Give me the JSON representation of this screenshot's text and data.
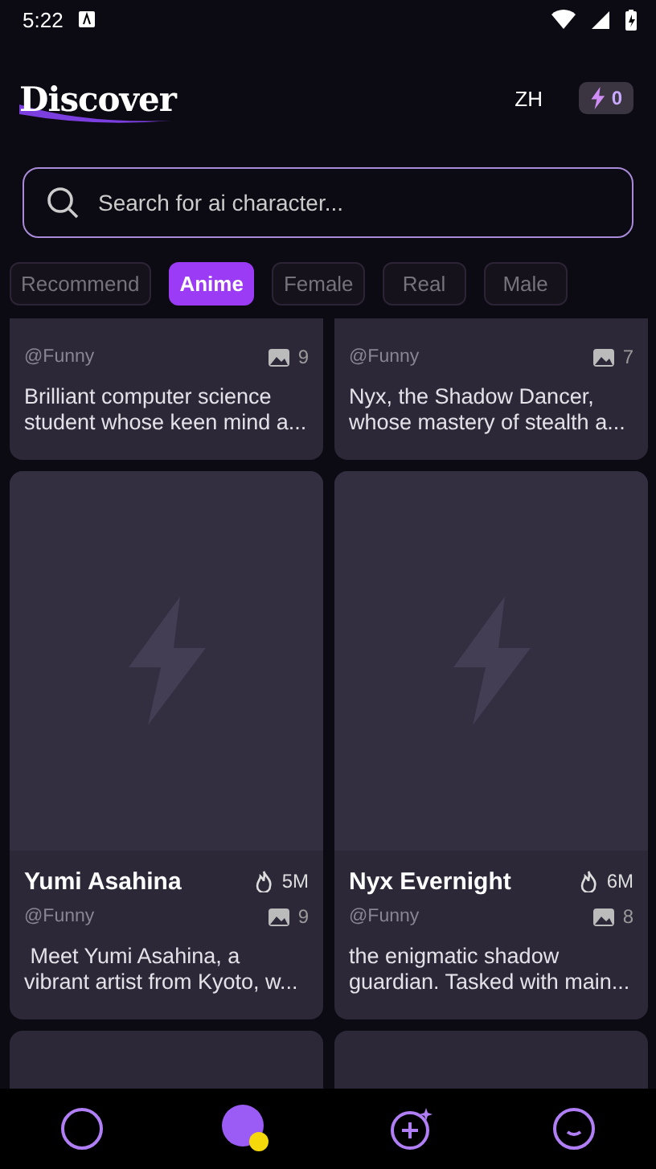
{
  "status_bar": {
    "time": "5:22"
  },
  "header": {
    "title": "Discover",
    "language": "ZH",
    "credits": "0"
  },
  "search": {
    "placeholder": "Search for ai character..."
  },
  "tabs": [
    {
      "label": "Recommend",
      "selected": false
    },
    {
      "label": "Anime",
      "selected": true
    },
    {
      "label": "Female",
      "selected": false
    },
    {
      "label": "Real",
      "selected": false
    },
    {
      "label": "Male",
      "selected": false
    }
  ],
  "cards": [
    {
      "handle": "@Funny",
      "images": "9",
      "description": "Brilliant computer science student whose keen mind a..."
    },
    {
      "handle": "@Funny",
      "images": "7",
      "description": "Nyx, the Shadow Dancer, whose mastery of stealth a..."
    },
    {
      "name": "Yumi Asahina",
      "popularity": "5M",
      "handle": "@Funny",
      "images": "9",
      "description": " Meet Yumi Asahina, a vibrant artist from Kyoto, w..."
    },
    {
      "name": "Nyx Evernight",
      "popularity": "6M",
      "handle": "@Funny",
      "images": "8",
      "description": "the enigmatic shadow guardian. Tasked with main..."
    },
    {
      "kind": "placeholder"
    },
    {
      "kind": "placeholder"
    }
  ],
  "bottom_nav": [
    {
      "kind": "explore",
      "selected": false
    },
    {
      "kind": "avatar",
      "selected": true
    },
    {
      "kind": "create",
      "selected": false
    },
    {
      "kind": "profile",
      "selected": false
    }
  ]
}
